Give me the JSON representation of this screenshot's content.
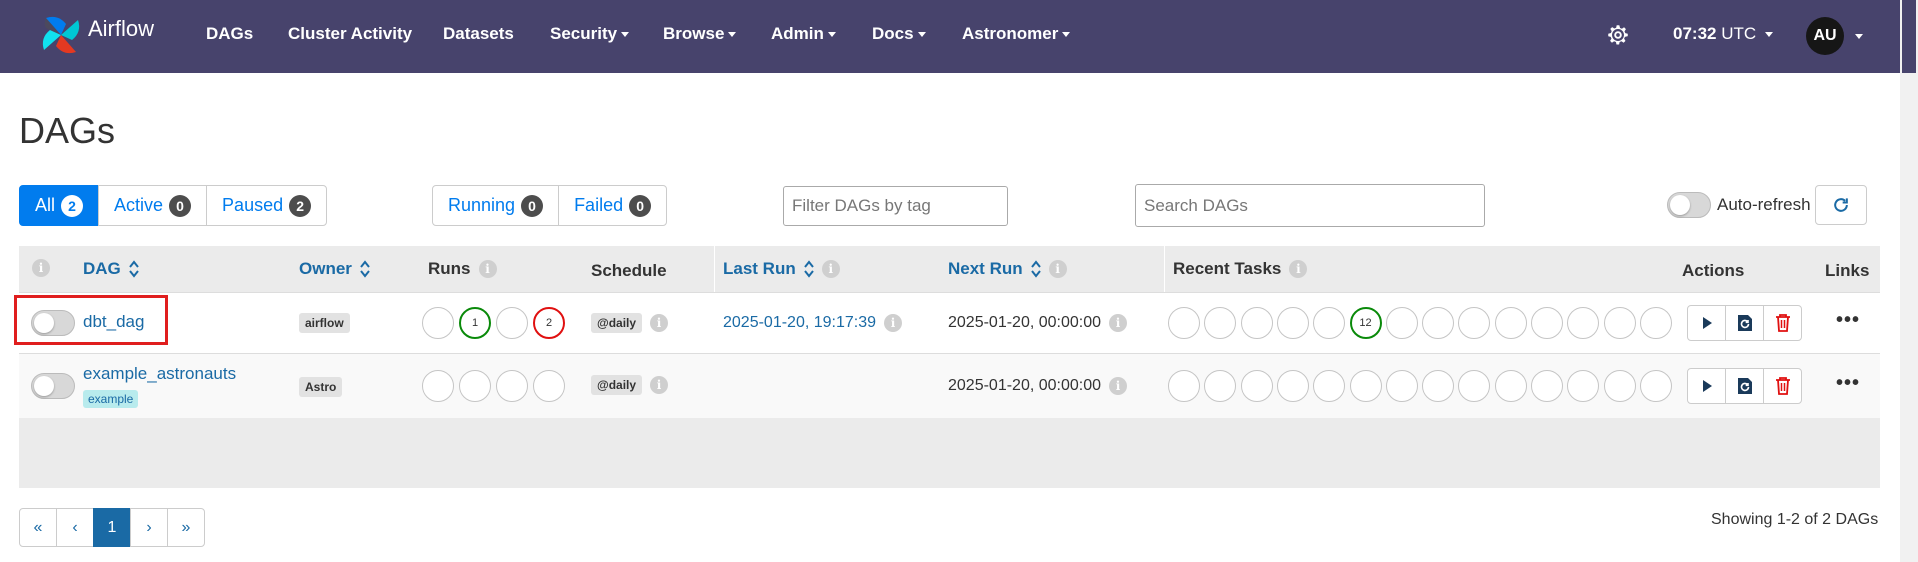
{
  "navbar": {
    "brand": "Airflow",
    "items": [
      {
        "label": "DAGs",
        "dropdown": false
      },
      {
        "label": "Cluster Activity",
        "dropdown": false
      },
      {
        "label": "Datasets",
        "dropdown": false
      },
      {
        "label": "Security",
        "dropdown": true
      },
      {
        "label": "Browse",
        "dropdown": true
      },
      {
        "label": "Admin",
        "dropdown": true
      },
      {
        "label": "Docs",
        "dropdown": true
      },
      {
        "label": "Astronomer",
        "dropdown": true
      }
    ],
    "time": "07:32",
    "timezone": "UTC",
    "avatar": "AU",
    "color": "#47436c"
  },
  "page": {
    "title": "DAGs"
  },
  "filters": {
    "status": [
      {
        "label": "All",
        "count": "2",
        "active": true
      },
      {
        "label": "Active",
        "count": "0",
        "active": false
      },
      {
        "label": "Paused",
        "count": "2",
        "active": false
      }
    ],
    "runs": [
      {
        "label": "Running",
        "count": "0"
      },
      {
        "label": "Failed",
        "count": "0"
      }
    ],
    "tag_placeholder": "Filter DAGs by tag",
    "search_placeholder": "Search DAGs",
    "auto_refresh_label": "Auto-refresh"
  },
  "table": {
    "headers": {
      "dag": "DAG",
      "owner": "Owner",
      "runs": "Runs",
      "schedule": "Schedule",
      "last_run": "Last Run",
      "next_run": "Next Run",
      "recent_tasks": "Recent Tasks",
      "actions": "Actions",
      "links": "Links"
    },
    "rows": [
      {
        "dag_id": "dbt_dag",
        "tag": "",
        "owner": "airflow",
        "schedule": "@daily",
        "last_run": "2025-01-20, 19:17:39",
        "next_run": "2025-01-20, 00:00:00",
        "runs": [
          {
            "label": "",
            "state": "none"
          },
          {
            "label": "1",
            "state": "success"
          },
          {
            "label": "",
            "state": "none"
          },
          {
            "label": "2",
            "state": "failed"
          }
        ],
        "tasks": [
          {
            "label": "",
            "state": "none"
          },
          {
            "label": "",
            "state": "none"
          },
          {
            "label": "",
            "state": "none"
          },
          {
            "label": "",
            "state": "none"
          },
          {
            "label": "",
            "state": "none"
          },
          {
            "label": "12",
            "state": "success"
          },
          {
            "label": "",
            "state": "none"
          },
          {
            "label": "",
            "state": "none"
          },
          {
            "label": "",
            "state": "none"
          },
          {
            "label": "",
            "state": "none"
          },
          {
            "label": "",
            "state": "none"
          },
          {
            "label": "",
            "state": "none"
          },
          {
            "label": "",
            "state": "none"
          },
          {
            "label": "",
            "state": "none"
          }
        ]
      },
      {
        "dag_id": "example_astronauts",
        "tag": "example",
        "owner": "Astro",
        "schedule": "@daily",
        "last_run": "",
        "next_run": "2025-01-20, 00:00:00",
        "runs": [
          {
            "label": "",
            "state": "none"
          },
          {
            "label": "",
            "state": "none"
          },
          {
            "label": "",
            "state": "none"
          },
          {
            "label": "",
            "state": "none"
          }
        ],
        "tasks": [
          {
            "label": "",
            "state": "none"
          },
          {
            "label": "",
            "state": "none"
          },
          {
            "label": "",
            "state": "none"
          },
          {
            "label": "",
            "state": "none"
          },
          {
            "label": "",
            "state": "none"
          },
          {
            "label": "",
            "state": "none"
          },
          {
            "label": "",
            "state": "none"
          },
          {
            "label": "",
            "state": "none"
          },
          {
            "label": "",
            "state": "none"
          },
          {
            "label": "",
            "state": "none"
          },
          {
            "label": "",
            "state": "none"
          },
          {
            "label": "",
            "state": "none"
          },
          {
            "label": "",
            "state": "none"
          },
          {
            "label": "",
            "state": "none"
          }
        ]
      }
    ]
  },
  "pagination": {
    "first": "«",
    "prev": "‹",
    "current": "1",
    "next": "›",
    "last": "»",
    "summary": "Showing 1-2 of 2 DAGs"
  },
  "colors": {
    "primary": "#017cee",
    "link": "#1a6aa5",
    "success": "#0a8a0a",
    "failed": "#e01010",
    "highlight": "#e01e1e"
  }
}
